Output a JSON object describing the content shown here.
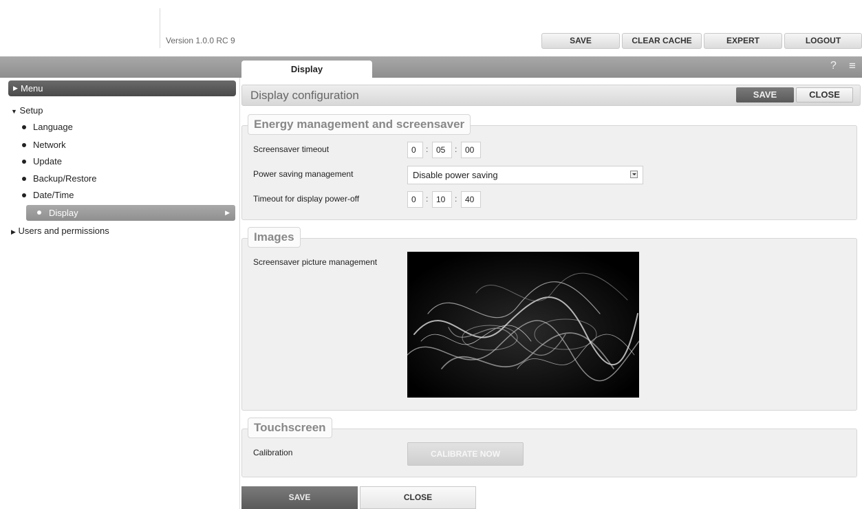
{
  "header": {
    "version": "Version 1.0.0 RC 9",
    "buttons": {
      "save": "SAVE",
      "clear_cache": "CLEAR CACHE",
      "expert": "EXPERT",
      "logout": "LOGOUT"
    }
  },
  "tabbar": {
    "active_tab": "Display",
    "help": "?",
    "menu": "≡"
  },
  "sidebar": {
    "menu_label": "Menu",
    "setup_label": "Setup",
    "items": [
      "Language",
      "Network",
      "Update",
      "Backup/Restore",
      "Date/Time",
      "Display"
    ],
    "selected": "Display",
    "users_label": "Users and permissions"
  },
  "main": {
    "title": "Display configuration",
    "save": "SAVE",
    "close": "CLOSE",
    "energy": {
      "legend": "Energy management and screensaver",
      "screensaver_timeout_label": "Screensaver timeout",
      "screensaver_timeout": {
        "h": "0",
        "m": "05",
        "s": "00"
      },
      "power_saving_label": "Power saving management",
      "power_saving_value": "Disable power saving",
      "poweroff_label": "Timeout for display power-off",
      "poweroff_timeout": {
        "h": "0",
        "m": "10",
        "s": "40"
      }
    },
    "images": {
      "legend": "Images",
      "picture_label": "Screensaver picture management"
    },
    "touch": {
      "legend": "Touchscreen",
      "calibration_label": "Calibration",
      "calibrate_button": "CALIBRATE NOW"
    },
    "bottom_save": "SAVE",
    "bottom_close": "CLOSE"
  }
}
